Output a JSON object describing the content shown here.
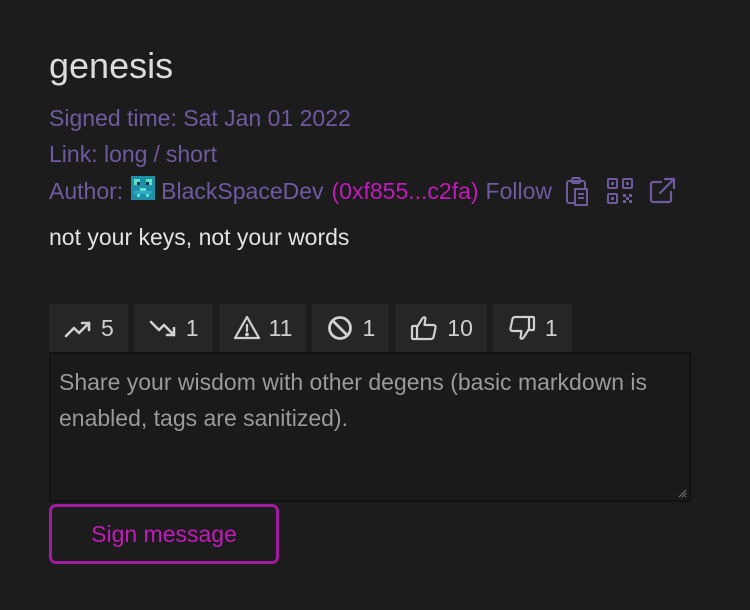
{
  "post": {
    "title": "genesis",
    "signed_label": "Signed time:",
    "signed_value": "Sat Jan 01 2022",
    "link_label": "Link:",
    "link_long": "long",
    "link_sep": "/",
    "link_short": "short",
    "author_label": "Author:",
    "author_name": "BlackSpaceDev",
    "author_address": "(0xf855...c2fa)",
    "follow_label": "Follow",
    "message": "not your keys, not your words"
  },
  "icons": {
    "copy": "clipboard-icon",
    "qr": "qr-code-icon",
    "external": "external-link-icon"
  },
  "reactions": [
    {
      "icon": "trending-up-icon",
      "count": "5"
    },
    {
      "icon": "trending-down-icon",
      "count": "1"
    },
    {
      "icon": "warning-icon",
      "count": "11"
    },
    {
      "icon": "ban-icon",
      "count": "1"
    },
    {
      "icon": "thumbs-up-icon",
      "count": "10"
    },
    {
      "icon": "thumbs-down-icon",
      "count": "1"
    }
  ],
  "composer": {
    "placeholder": "Share your wisdom with other degens (basic markdown is enabled, tags are sanitized)."
  },
  "actions": {
    "sign_label": "Sign message"
  },
  "colors": {
    "background": "#1c1c1c",
    "meta": "#6f5aa0",
    "accent": "#c21bbb"
  }
}
